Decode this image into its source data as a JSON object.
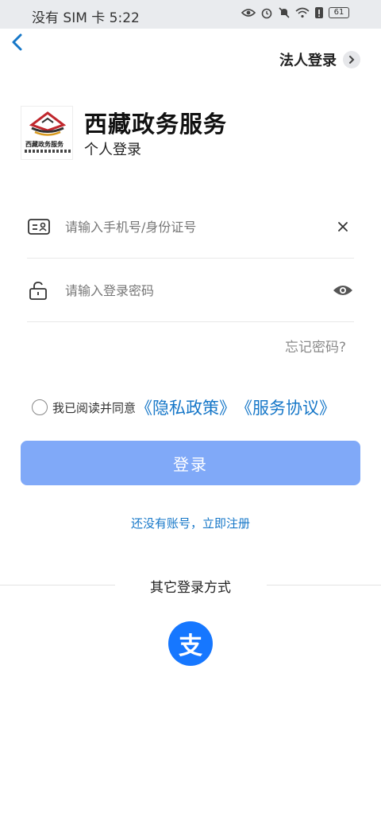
{
  "status_bar": {
    "carrier_time": "没有 SIM 卡 5:22",
    "battery": "61"
  },
  "header": {
    "corp_login_label": "法人登录"
  },
  "brand": {
    "logo_text": "西藏政务服务",
    "app_name": "西藏政务服务",
    "login_type": "个人登录"
  },
  "form": {
    "account_placeholder": "请输入手机号/身份证号",
    "password_placeholder": "请输入登录密码",
    "forgot_label": "忘记密码?"
  },
  "agreement": {
    "prefix": "我已阅读并同意",
    "privacy_link": "《隐私政策》",
    "service_link": "《服务协议》"
  },
  "login_button": "登录",
  "register_link": "还没有账号，立即注册",
  "other_login": {
    "label": "其它登录方式",
    "alipay_glyph": "支"
  },
  "colors": {
    "primary": "#80a9f8",
    "link": "#1677c8",
    "alipay": "#1677ff"
  }
}
